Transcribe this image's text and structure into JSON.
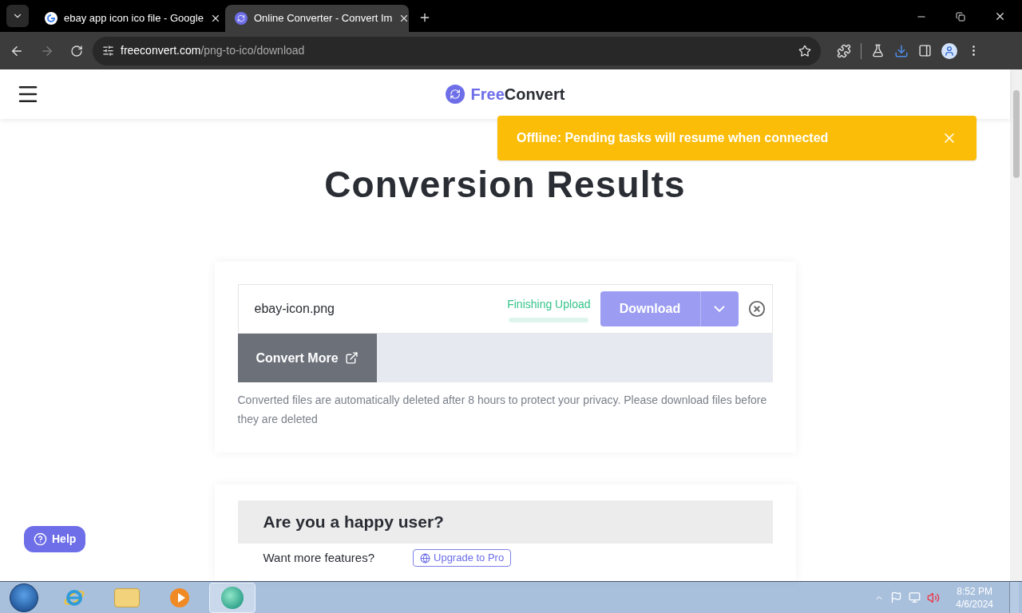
{
  "browser": {
    "tabs": [
      {
        "title": "ebay app icon ico file - Google",
        "selected": false,
        "kind": "google"
      },
      {
        "title": "Online Converter - Convert Im",
        "selected": true,
        "kind": "freeconvert"
      }
    ],
    "url": {
      "host": "freeconvert.com",
      "path": "/png-to-ico/download"
    }
  },
  "header": {
    "logo": {
      "first": "Free",
      "second": "Convert"
    }
  },
  "toast": {
    "message": "Offline: Pending tasks will resume when connected"
  },
  "title": "Conversion Results",
  "file": {
    "name": "ebay-icon.png",
    "status": "Finishing Upload",
    "level": 0,
    "download_label": "Download",
    "download_disabled": true
  },
  "convert_more": "Convert More",
  "notice": "Converted files are automatically deleted after 8 hours to protect your privacy. Please download files before they are deleted",
  "feedback": {
    "heading": "Are you a happy user?",
    "prompt": "Want more features?",
    "upgrade": "Upgrade to Pro"
  },
  "help": "Help",
  "taskbar": {
    "apps": [
      {
        "kind": "ie",
        "selected": false
      },
      {
        "kind": "explorer",
        "selected": false
      },
      {
        "kind": "media",
        "selected": false
      },
      {
        "kind": "browser",
        "selected": true
      }
    ],
    "time": "8:52 PM",
    "date": "4/6/2024"
  }
}
